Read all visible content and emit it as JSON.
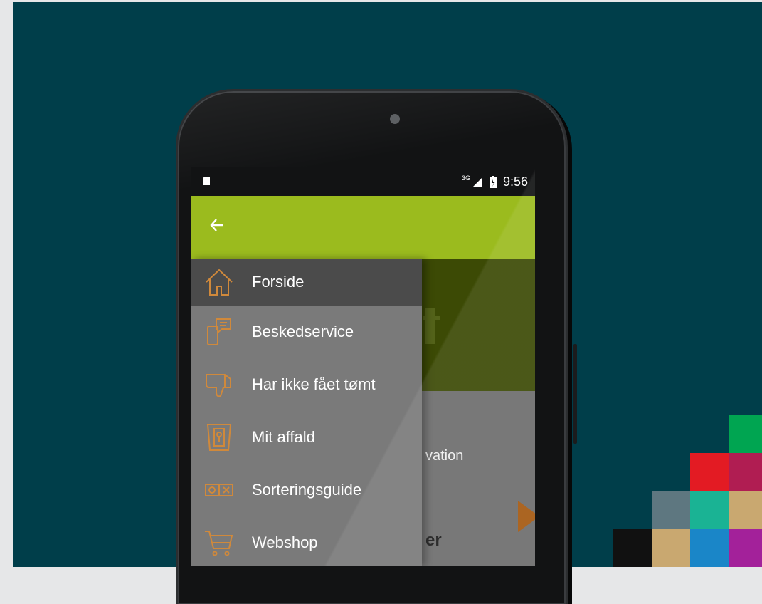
{
  "status_bar": {
    "network": "3G",
    "time": "9:56"
  },
  "app_bar": {
    "back_icon": "arrow-left-icon"
  },
  "background_content": {
    "peek_text_1": "vation",
    "peek_text_2": "er"
  },
  "drawer": {
    "items": [
      {
        "label": "Forside",
        "icon": "house-icon",
        "active": true
      },
      {
        "label": "Beskedservice",
        "icon": "phone-message-icon",
        "active": false
      },
      {
        "label": "Har ikke fået tømt",
        "icon": "thumbs-down-icon",
        "active": false
      },
      {
        "label": "Mit affald",
        "icon": "bin-keyhole-icon",
        "active": false
      },
      {
        "label": "Sorteringsguide",
        "icon": "sorting-bins-icon",
        "active": false
      },
      {
        "label": "Webshop",
        "icon": "shopping-cart-icon",
        "active": false
      }
    ]
  },
  "colors": {
    "background": "#003e4a",
    "app_bar": "#9bbb1e",
    "icon_accent": "#d0893b",
    "tiles": [
      "#00a551",
      "#e31b23",
      "#b01d52",
      "#5e7780",
      "#1ab394",
      "#c9a870",
      "#111111",
      "#c9a870",
      "#1a86c8",
      "#a3219a"
    ]
  }
}
